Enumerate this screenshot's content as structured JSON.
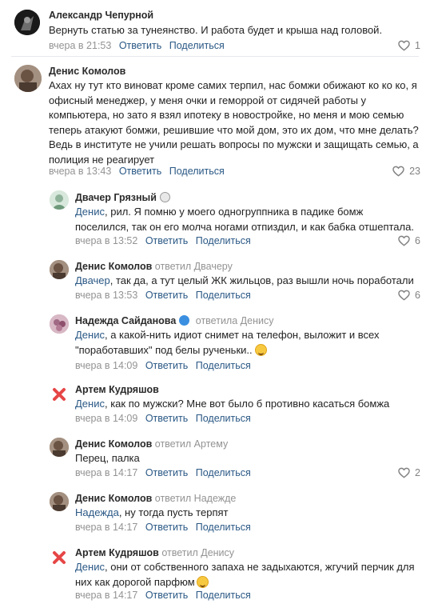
{
  "comments": [
    {
      "author": "Александр Чепурной",
      "text": "Вернуть статью за тунеянство. И работа будет и крыша над головой.",
      "time": "вчера в 21:53",
      "reply": "Ответить",
      "share": "Поделиться",
      "likes": "1"
    },
    {
      "author": "Денис Комолов",
      "text": "Ахах ну тут кто виноват кроме самих терпил, нас бомжи обижают ко ко ко, я офисный менеджер, у меня очки и геморрой от сидячей работы у компьютера, но зато я взял ипотеку в новостройке, но меня и мою семью теперь атакуют бомжи, решившие что мой дом, это их дом, что мне делать? Ведь в институте не учили решать вопросы по мужски и защищать семью, а полиция не реагирует",
      "time": "вчера в 13:43",
      "reply": "Ответить",
      "share": "Поделиться",
      "likes": "23"
    }
  ],
  "replies": [
    {
      "author": "Двачер Грязный",
      "mention": "Денис",
      "text": ", рил. Я помню у моего одногруппника в падике бомж поселился, так он его молча ногами отпиздил, и как бабка отшептала.",
      "time": "вчера в 13:52",
      "reply": "Ответить",
      "share": "Поделиться",
      "likes": "6"
    },
    {
      "author": "Денис Комолов",
      "replied_to": "ответил Двачеру",
      "mention": "Двачер",
      "text": ", так да, а тут целый ЖК жильцов, раз вышли ночь поработали",
      "time": "вчера в 13:53",
      "reply": "Ответить",
      "share": "Поделиться",
      "likes": "6"
    },
    {
      "author": "Надежда Сайданова",
      "replied_to": "ответила Денису",
      "mention": "Денис",
      "text": ", а какой-нить идиот снимет на телефон, выложит и всех \"поработавших\" под белы рученьки..",
      "time": "вчера в 14:09",
      "reply": "Ответить",
      "share": "Поделиться",
      "likes": ""
    },
    {
      "author": "Артем Кудряшов",
      "mention": "Денис",
      "text": ", как по мужски? Мне вот было б противно касаться бомжа",
      "time": "вчера в 14:09",
      "reply": "Ответить",
      "share": "Поделиться",
      "likes": ""
    },
    {
      "author": "Денис Комолов",
      "replied_to": "ответил Артему",
      "mention": "",
      "text": "Перец, палка",
      "time": "вчера в 14:17",
      "reply": "Ответить",
      "share": "Поделиться",
      "likes": "2"
    },
    {
      "author": "Денис Комолов",
      "replied_to": "ответил Надежде",
      "mention": "Надежда",
      "text": ", ну тогда пусть терпят",
      "time": "вчера в 14:17",
      "reply": "Ответить",
      "share": "Поделиться",
      "likes": ""
    },
    {
      "author": "Артем Кудряшов",
      "replied_to": "ответил Денису",
      "mention": "Денис",
      "text": ", они от собственного запаха не задыхаются, жгучий перчик для них как дорогой парфюм",
      "time": "вчера в 14:17",
      "reply": "Ответить",
      "share": "Поделиться",
      "likes": ""
    }
  ],
  "colors": {
    "link": "#2a5885",
    "meta": "#939393",
    "divider": "#e7e8ec",
    "deleted_avatar": "#e64646"
  }
}
